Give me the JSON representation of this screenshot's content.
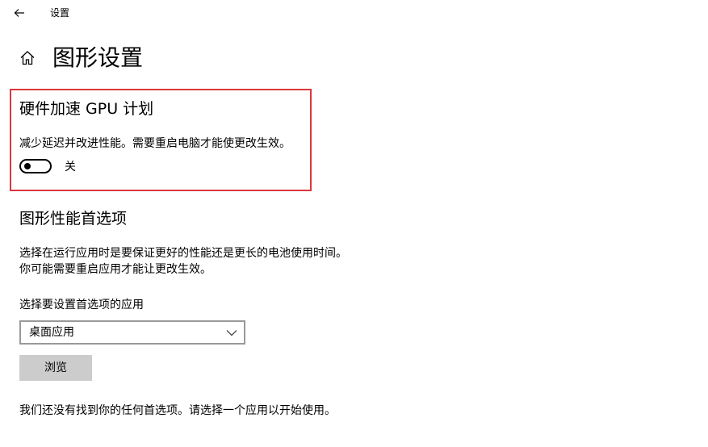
{
  "window": {
    "app_title": "设置"
  },
  "page": {
    "title": "图形设置"
  },
  "gpu_scheduling": {
    "title": "硬件加速 GPU 计划",
    "description": "减少延迟并改进性能。需要重启电脑才能使更改生效。",
    "toggle_state_label": "关",
    "toggle_on": false,
    "highlight_color": "#d9383d"
  },
  "graphics_preference": {
    "title": "图形性能首选项",
    "description_line1": "选择在运行应用时是要保证更好的性能还是更长的电池使用时间。",
    "description_line2": "你可能需要重启应用才能让更改生效。",
    "select_label": "选择要设置首选项的应用",
    "select_value": "桌面应用",
    "browse_label": "浏览",
    "empty_message": "我们还没有找到你的任何首选项。请选择一个应用以开始使用。"
  },
  "icons": {
    "back": "back-arrow-icon",
    "home": "home-icon",
    "dropdown": "chevron-down-icon"
  }
}
